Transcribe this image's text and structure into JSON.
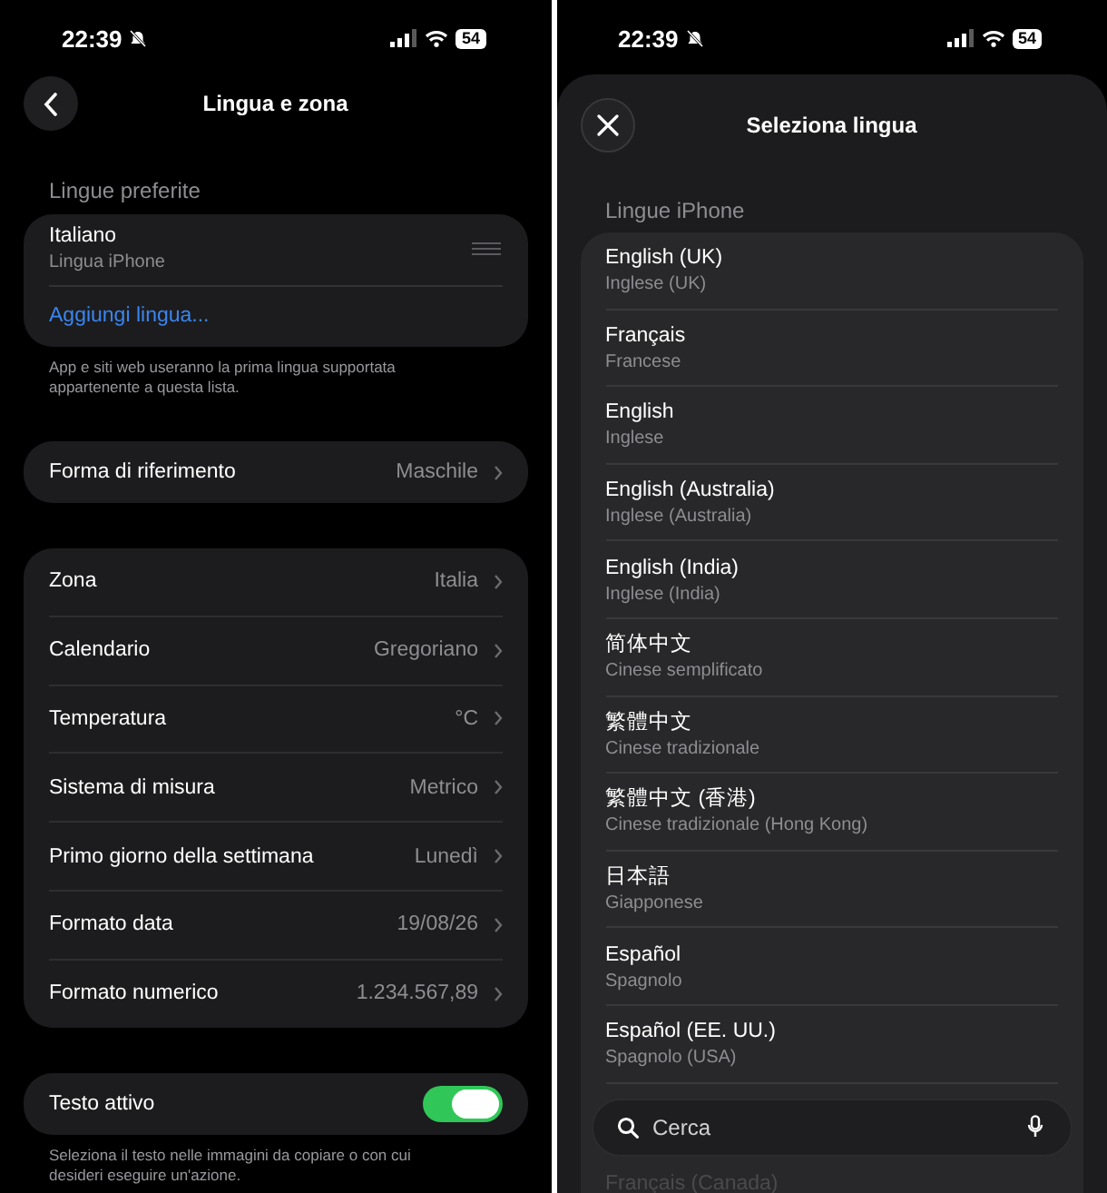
{
  "left_screen": {
    "status_bar": {
      "time": "22:39",
      "battery": "54"
    },
    "title": "Lingua e zona",
    "preferred_languages": {
      "header": "Lingue preferite",
      "languages": [
        {
          "name": "Italiano",
          "subtitle": "Lingua iPhone"
        }
      ],
      "add_link": "Aggiungi lingua...",
      "footer": "App e siti web useranno la prima lingua supportata appartenente a questa lista."
    },
    "form_of_address": {
      "label": "Forma di riferimento",
      "value": "Maschile"
    },
    "region_settings": [
      {
        "label": "Zona",
        "value": "Italia"
      },
      {
        "label": "Calendario",
        "value": "Gregoriano"
      },
      {
        "label": "Temperatura",
        "value": "°C"
      },
      {
        "label": "Sistema di misura",
        "value": "Metrico"
      },
      {
        "label": "Primo giorno della settimana",
        "value": "Lunedì"
      },
      {
        "label": "Formato data",
        "value": "19/08/26"
      },
      {
        "label": "Formato numerico",
        "value": "1.234.567,89"
      }
    ],
    "live_text": {
      "label": "Testo attivo",
      "on": true,
      "footer": "Seleziona il testo nelle immagini da copiare o con cui desideri eseguire un'azione."
    }
  },
  "right_screen": {
    "status_bar": {
      "time": "22:39",
      "battery": "54"
    },
    "title": "Seleziona lingua",
    "section_header": "Lingue iPhone",
    "languages": [
      {
        "name": "English (UK)",
        "subtitle": "Inglese (UK)"
      },
      {
        "name": "Français",
        "subtitle": "Francese"
      },
      {
        "name": "English",
        "subtitle": "Inglese"
      },
      {
        "name": "English (Australia)",
        "subtitle": "Inglese (Australia)"
      },
      {
        "name": "English (India)",
        "subtitle": "Inglese (India)"
      },
      {
        "name": "简体中文",
        "subtitle": "Cinese semplificato"
      },
      {
        "name": "繁體中文",
        "subtitle": "Cinese tradizionale"
      },
      {
        "name": "繁體中文 (香港)",
        "subtitle": "Cinese tradizionale (Hong Kong)"
      },
      {
        "name": "日本語",
        "subtitle": "Giapponese"
      },
      {
        "name": "Español",
        "subtitle": "Spagnolo"
      },
      {
        "name": "Español (EE. UU.)",
        "subtitle": "Spagnolo (USA)"
      }
    ],
    "partial_language": "Français (Canada)",
    "search": {
      "placeholder": "Cerca"
    }
  }
}
